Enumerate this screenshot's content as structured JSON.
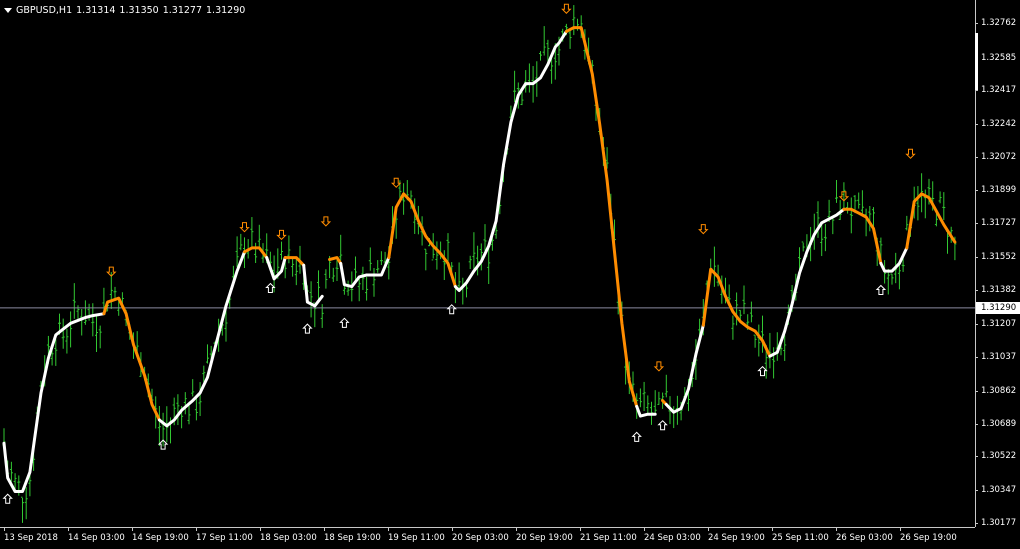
{
  "header": {
    "symbol": "GBPUSD,H1",
    "open": "1.31314",
    "high": "1.31350",
    "low": "1.31277",
    "close": "1.31290"
  },
  "price_axis": {
    "ticks": [
      "1.32762",
      "1.32585",
      "1.32417",
      "1.32242",
      "1.32072",
      "1.31899",
      "1.31727",
      "1.31552",
      "1.31382",
      "1.31207",
      "1.31037",
      "1.30862",
      "1.30689",
      "1.30522",
      "1.30347",
      "1.30177"
    ],
    "current_price": "1.31290"
  },
  "time_axis": {
    "ticks": [
      "13 Sep 2018",
      "14 Sep 03:00",
      "14 Sep 19:00",
      "17 Sep 11:00",
      "18 Sep 03:00",
      "18 Sep 19:00",
      "19 Sep 11:00",
      "20 Sep 03:00",
      "20 Sep 19:00",
      "21 Sep 11:00",
      "24 Sep 03:00",
      "24 Sep 19:00",
      "25 Sep 11:00",
      "26 Sep 03:00",
      "26 Sep 19:00"
    ]
  },
  "colors": {
    "background": "#000000",
    "bars": "#32c832",
    "trend_up": "#ffffff",
    "trend_down": "#ff8c00",
    "arrow_up": "#ffffff",
    "arrow_down": "#ff8c00",
    "current_price_line": "#8a8aa0"
  },
  "chart_data": {
    "type": "line",
    "title": "GBPUSD,H1",
    "ylim": [
      1.30177,
      1.32862
    ],
    "current_price": 1.3129,
    "bar_count": 150,
    "trend_line": [
      [
        0,
        1.3059
      ],
      [
        1,
        1.3041
      ],
      [
        3,
        1.3034
      ],
      [
        5,
        1.3034
      ],
      [
        7,
        1.3044
      ],
      [
        10,
        1.3085
      ],
      [
        12,
        1.3103
      ],
      [
        14,
        1.3115
      ],
      [
        16,
        1.3118
      ],
      [
        18,
        1.3121
      ],
      [
        22,
        1.3124
      ],
      [
        24,
        1.3125
      ],
      [
        27,
        1.3126
      ],
      [
        28,
        1.3132
      ],
      [
        31,
        1.3134
      ],
      [
        33,
        1.3126
      ],
      [
        35,
        1.311
      ],
      [
        38,
        1.3094
      ],
      [
        40,
        1.3079
      ],
      [
        42,
        1.3071
      ],
      [
        44,
        1.3068
      ],
      [
        46,
        1.3071
      ],
      [
        48,
        1.3076
      ],
      [
        51,
        1.3081
      ],
      [
        53,
        1.3085
      ],
      [
        55,
        1.3093
      ],
      [
        57,
        1.3108
      ],
      [
        60,
        1.313
      ],
      [
        63,
        1.3148
      ],
      [
        65,
        1.3158
      ],
      [
        67,
        1.316
      ],
      [
        69,
        1.316
      ],
      [
        71,
        1.3155
      ],
      [
        73,
        1.3144
      ],
      [
        75,
        1.3148
      ],
      [
        76,
        1.3155
      ],
      [
        79,
        1.3155
      ],
      [
        81,
        1.3151
      ],
      [
        82,
        1.3132
      ],
      [
        84,
        1.313
      ],
      [
        86,
        1.3135
      ],
      [
        88,
        1.3154
      ],
      [
        90,
        1.3155
      ],
      [
        91,
        1.3152
      ],
      [
        92,
        1.3141
      ],
      [
        94,
        1.314
      ],
      [
        96,
        1.3145
      ],
      [
        98,
        1.3146
      ],
      [
        100,
        1.3146
      ],
      [
        102,
        1.3146
      ],
      [
        104,
        1.3155
      ],
      [
        106,
        1.3181
      ],
      [
        108,
        1.3188
      ],
      [
        110,
        1.3184
      ],
      [
        112,
        1.3174
      ],
      [
        114,
        1.3166
      ],
      [
        116,
        1.3161
      ],
      [
        118,
        1.3157
      ],
      [
        120,
        1.3152
      ],
      [
        122,
        1.314
      ],
      [
        123,
        1.3138
      ],
      [
        125,
        1.3142
      ],
      [
        127,
        1.3148
      ],
      [
        129,
        1.3153
      ],
      [
        131,
        1.3161
      ],
      [
        133,
        1.3174
      ],
      [
        135,
        1.3203
      ],
      [
        137,
        1.3225
      ],
      [
        139,
        1.3239
      ],
      [
        141,
        1.3245
      ],
      [
        143,
        1.3245
      ],
      [
        145,
        1.3248
      ],
      [
        147,
        1.3255
      ],
      [
        149,
        1.3264
      ],
      [
        150,
        1.3266
      ],
      [
        152,
        1.3272
      ],
      [
        154,
        1.3274
      ],
      [
        156,
        1.3274
      ],
      [
        157,
        1.3266
      ],
      [
        159,
        1.325
      ],
      [
        161,
        1.3224
      ],
      [
        163,
        1.3195
      ],
      [
        165,
        1.3158
      ],
      [
        167,
        1.3121
      ],
      [
        169,
        1.3091
      ],
      [
        171,
        1.3078
      ],
      [
        172,
        1.3073
      ],
      [
        174,
        1.3074
      ],
      [
        176,
        1.3074
      ],
      [
        178,
        1.3081
      ],
      [
        179,
        1.3079
      ],
      [
        181,
        1.3075
      ],
      [
        183,
        1.3077
      ],
      [
        185,
        1.3087
      ],
      [
        187,
        1.3105
      ],
      [
        189,
        1.312
      ],
      [
        191,
        1.3149
      ],
      [
        193,
        1.3145
      ],
      [
        195,
        1.3135
      ],
      [
        197,
        1.3127
      ],
      [
        199,
        1.3122
      ],
      [
        201,
        1.3119
      ],
      [
        203,
        1.3117
      ],
      [
        205,
        1.3112
      ],
      [
        207,
        1.3104
      ],
      [
        209,
        1.3106
      ],
      [
        211,
        1.3117
      ],
      [
        213,
        1.3131
      ],
      [
        215,
        1.3147
      ],
      [
        217,
        1.3158
      ],
      [
        219,
        1.3167
      ],
      [
        221,
        1.3173
      ],
      [
        223,
        1.3175
      ],
      [
        225,
        1.3177
      ],
      [
        227,
        1.318
      ],
      [
        229,
        1.318
      ],
      [
        231,
        1.3178
      ],
      [
        233,
        1.3176
      ],
      [
        235,
        1.317
      ],
      [
        237,
        1.3152
      ],
      [
        238,
        1.3148
      ],
      [
        240,
        1.3148
      ],
      [
        242,
        1.3152
      ],
      [
        244,
        1.316
      ],
      [
        246,
        1.3184
      ],
      [
        248,
        1.3188
      ],
      [
        250,
        1.3186
      ],
      [
        252,
        1.3179
      ],
      [
        254,
        1.3172
      ],
      [
        256,
        1.3166
      ],
      [
        257,
        1.3163
      ]
    ],
    "trend_colors": [
      {
        "from": 0,
        "to": 27,
        "dir": "up"
      },
      {
        "from": 27,
        "to": 42,
        "dir": "down"
      },
      {
        "from": 42,
        "to": 65,
        "dir": "up"
      },
      {
        "from": 65,
        "to": 71,
        "dir": "down"
      },
      {
        "from": 71,
        "to": 76,
        "dir": "up"
      },
      {
        "from": 76,
        "to": 81,
        "dir": "down"
      },
      {
        "from": 81,
        "to": 87,
        "dir": "up"
      },
      {
        "from": 87,
        "to": 91,
        "dir": "down"
      },
      {
        "from": 91,
        "to": 104,
        "dir": "up"
      },
      {
        "from": 104,
        "to": 122,
        "dir": "down"
      },
      {
        "from": 122,
        "to": 152,
        "dir": "up"
      },
      {
        "from": 152,
        "to": 171,
        "dir": "down"
      },
      {
        "from": 171,
        "to": 177,
        "dir": "up"
      },
      {
        "from": 177,
        "to": 179,
        "dir": "down"
      },
      {
        "from": 179,
        "to": 189,
        "dir": "up"
      },
      {
        "from": 189,
        "to": 207,
        "dir": "down"
      },
      {
        "from": 207,
        "to": 227,
        "dir": "up"
      },
      {
        "from": 227,
        "to": 237,
        "dir": "down"
      },
      {
        "from": 237,
        "to": 244,
        "dir": "up"
      },
      {
        "from": 244,
        "to": 257,
        "dir": "down"
      }
    ],
    "arrows_up": [
      [
        1,
        1.303
      ],
      [
        43,
        1.3058
      ],
      [
        72,
        1.3139
      ],
      [
        82,
        1.3118
      ],
      [
        92,
        1.3121
      ],
      [
        121,
        1.3128
      ],
      [
        171,
        1.3062
      ],
      [
        178,
        1.3068
      ],
      [
        205,
        1.3096
      ],
      [
        237,
        1.3138
      ]
    ],
    "arrows_down": [
      [
        29,
        1.3148
      ],
      [
        65,
        1.3171
      ],
      [
        75,
        1.3167
      ],
      [
        87,
        1.3174
      ],
      [
        106,
        1.3194
      ],
      [
        152,
        1.3284
      ],
      [
        177,
        1.3099
      ],
      [
        189,
        1.317
      ],
      [
        227,
        1.3187
      ],
      [
        245,
        1.3209
      ]
    ]
  }
}
